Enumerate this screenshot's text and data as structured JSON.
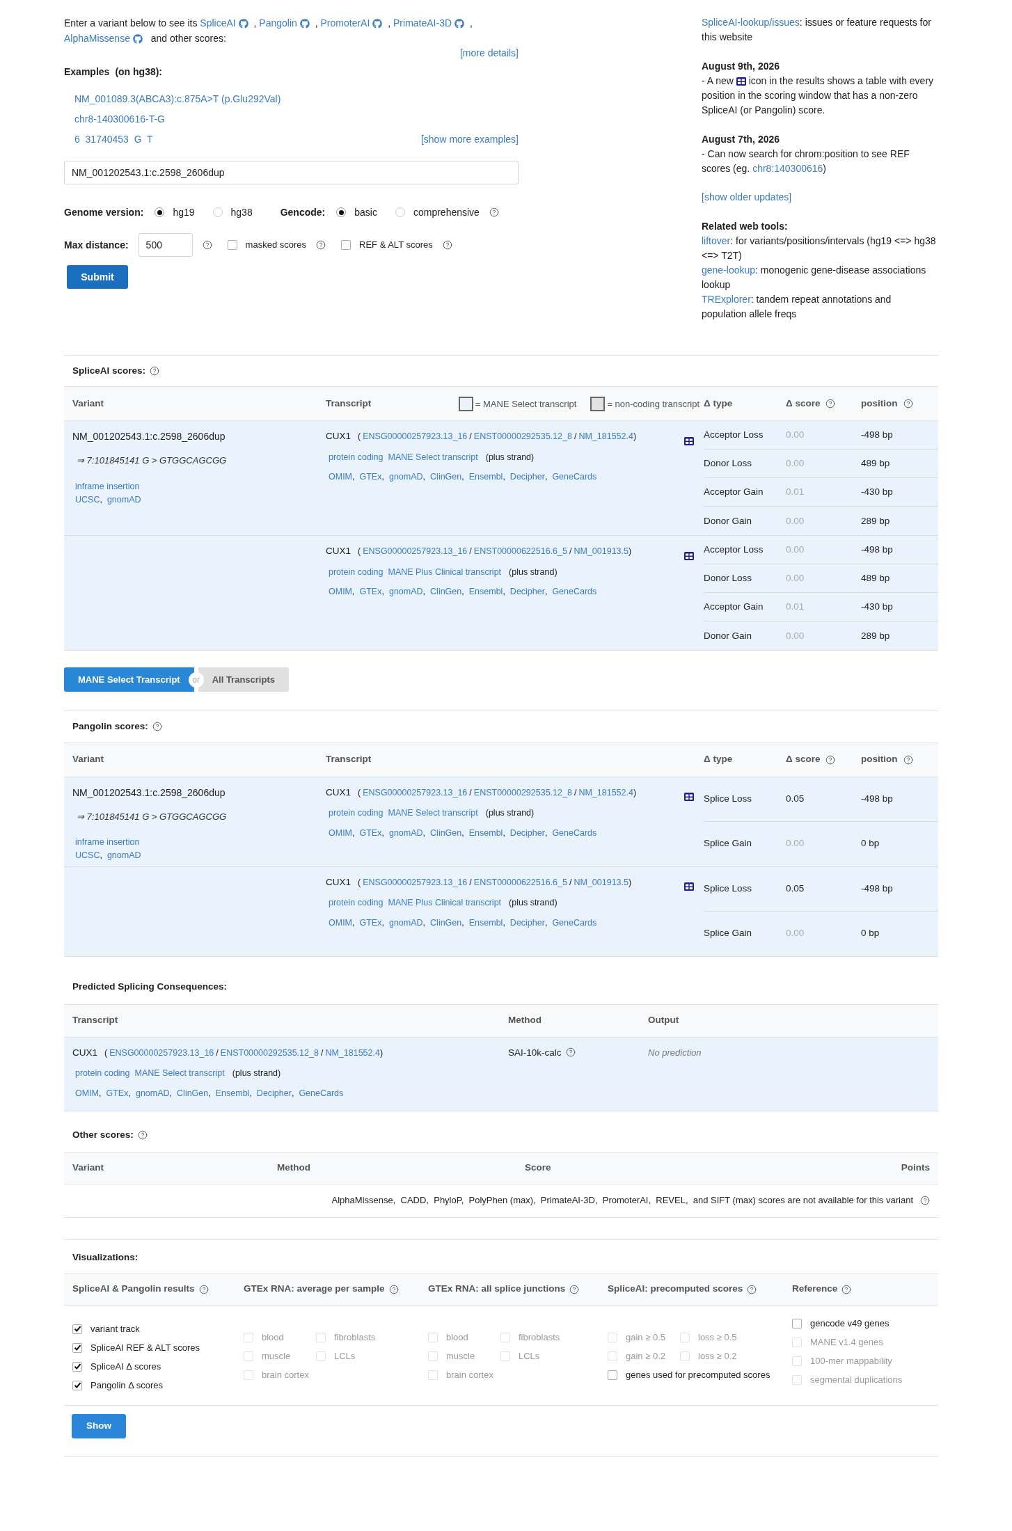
{
  "intro": {
    "parts": [
      {
        "kind": "text",
        "text": "Enter a variant below to see its "
      },
      {
        "kind": "link",
        "text": "SpliceAI",
        "github": true
      },
      {
        "kind": "text",
        "text": " , "
      },
      {
        "kind": "link",
        "text": "Pangolin",
        "github": true
      },
      {
        "kind": "text",
        "text": " , "
      },
      {
        "kind": "link",
        "text": "PromoterAI",
        "github": true
      },
      {
        "kind": "text",
        "text": " , "
      },
      {
        "kind": "link",
        "text": "PrimateAI-3D",
        "github": true
      },
      {
        "kind": "text",
        "text": " , "
      },
      {
        "kind": "link",
        "text": "AlphaMissense",
        "github": true
      },
      {
        "kind": "text",
        "text": "  and other scores:"
      }
    ],
    "more_details": "[more details]"
  },
  "examples": {
    "title": "Examples",
    "note": "(on hg38):",
    "items": [
      "NM_001089.3(ABCA3):c.875A>T (p.Glu292Val)",
      "chr8-140300616-T-G",
      "6  31740453  G  T"
    ],
    "show_more": "[show more examples]"
  },
  "variant_input": {
    "value": "NM_001202543.1:c.2598_2606dup"
  },
  "genome_version": {
    "label": "Genome version:",
    "options": [
      {
        "label": "hg19",
        "selected": true
      },
      {
        "label": "hg38",
        "selected": false
      }
    ]
  },
  "gencode": {
    "label": "Gencode:",
    "options": [
      {
        "label": "basic",
        "selected": true
      },
      {
        "label": "comprehensive",
        "selected": false
      }
    ]
  },
  "max_distance": {
    "label": "Max distance:",
    "value": "500"
  },
  "score_options": [
    {
      "label": "masked scores",
      "checked": false
    },
    {
      "label": "REF & ALT scores",
      "checked": false
    }
  ],
  "submit": "Submit",
  "sidebar": {
    "issues": [
      {
        "kind": "link",
        "text": "SpliceAI-lookup/issues"
      },
      {
        "kind": "text",
        "text": ": issues or feature requests for this website"
      }
    ],
    "updates": [
      {
        "date": "August 9th, 2026",
        "parts": [
          {
            "kind": "text",
            "text": "- A new "
          },
          {
            "kind": "icon"
          },
          {
            "kind": "text",
            "text": " icon in the results shows a table with every position in the scoring window that has a non-zero SpliceAI (or Pangolin) score."
          }
        ]
      },
      {
        "date": "August 7th, 2026",
        "parts": [
          {
            "kind": "text",
            "text": "- Can now search for chrom:position to see REF scores (eg. "
          },
          {
            "kind": "link",
            "text": "chr8:140300616"
          },
          {
            "kind": "text",
            "text": ")"
          }
        ]
      }
    ],
    "older": "[show older updates]",
    "related_title": "Related web tools:",
    "related": [
      [
        {
          "kind": "link",
          "text": "liftover"
        },
        {
          "kind": "text",
          "text": ": for variants/positions/intervals (hg19 <=> hg38 <=> T2T)"
        }
      ],
      [
        {
          "kind": "link",
          "text": "gene-lookup"
        },
        {
          "kind": "text",
          "text": ": monogenic gene-disease associations lookup"
        }
      ],
      [
        {
          "kind": "link",
          "text": "TRExplorer"
        },
        {
          "kind": "text",
          "text": ": tandem repeat annotations and population allele freqs"
        }
      ]
    ]
  },
  "spliceai": {
    "title": "SpliceAI scores:",
    "columns": [
      {
        "label": "Variant",
        "help": false
      },
      {
        "label": "Transcript",
        "help": false
      },
      {
        "label": "Δ type",
        "help": false
      },
      {
        "label": "Δ score",
        "help": true
      },
      {
        "label": "position",
        "help": true
      }
    ],
    "legend": [
      {
        "label": "= MANE Select transcript",
        "color": "#eaf2fc"
      },
      {
        "label": "= non-coding transcript",
        "color": "#e2e2e2"
      }
    ],
    "variant": {
      "hgvs": "NM_001202543.1:c.2598_2606dup",
      "normalized": "⇒ 7:101845141 G > GTGGCAGCGG",
      "consequence": "inframe insertion",
      "links": [
        {
          "label": "UCSC",
          "separator": ","
        },
        {
          "label": "gnomAD"
        }
      ]
    },
    "transcripts": [
      {
        "gene": "CUX1",
        "open": "(",
        "close": ")",
        "ids": [
          {
            "label": "ENSG00000257923.13_16",
            "separator": "/"
          },
          {
            "label": "ENST00000292535.12_8",
            "separator": "/"
          },
          {
            "label": "NM_181552.4"
          }
        ],
        "biotype": "protein coding",
        "mane": "MANE Select transcript",
        "strand": "(plus strand)",
        "links": [
          {
            "label": "OMIM",
            "separator": ","
          },
          {
            "label": "GTEx",
            "separator": ","
          },
          {
            "label": "gnomAD",
            "separator": ","
          },
          {
            "label": "ClinGen",
            "separator": ","
          },
          {
            "label": "Ensembl",
            "separator": ","
          },
          {
            "label": "Decipher",
            "separator": ","
          },
          {
            "label": "GeneCards"
          }
        ],
        "scores": [
          {
            "type": "Acceptor Loss",
            "score": "0.00",
            "dimmed": true,
            "position": "-498 bp"
          },
          {
            "type": "Donor Loss",
            "score": "0.00",
            "dimmed": true,
            "position": "489 bp"
          },
          {
            "type": "Acceptor Gain",
            "score": "0.01",
            "dimmed": true,
            "position": "-430 bp"
          },
          {
            "type": "Donor Gain",
            "score": "0.00",
            "dimmed": true,
            "position": "289 bp"
          }
        ]
      },
      {
        "gene": "CUX1",
        "open": "(",
        "close": ")",
        "ids": [
          {
            "label": "ENSG00000257923.13_16",
            "separator": "/"
          },
          {
            "label": "ENST00000622516.6_5",
            "separator": "/"
          },
          {
            "label": "NM_001913.5"
          }
        ],
        "biotype": "protein coding",
        "mane": "MANE Plus Clinical transcript",
        "strand": "(plus strand)",
        "links": [
          {
            "label": "OMIM",
            "separator": ","
          },
          {
            "label": "GTEx",
            "separator": ","
          },
          {
            "label": "gnomAD",
            "separator": ","
          },
          {
            "label": "ClinGen",
            "separator": ","
          },
          {
            "label": "Ensembl",
            "separator": ","
          },
          {
            "label": "Decipher",
            "separator": ","
          },
          {
            "label": "GeneCards"
          }
        ],
        "scores": [
          {
            "type": "Acceptor Loss",
            "score": "0.00",
            "dimmed": true,
            "position": "-498 bp"
          },
          {
            "type": "Donor Loss",
            "score": "0.00",
            "dimmed": true,
            "position": "489 bp"
          },
          {
            "type": "Acceptor Gain",
            "score": "0.01",
            "dimmed": true,
            "position": "-430 bp"
          },
          {
            "type": "Donor Gain",
            "score": "0.00",
            "dimmed": true,
            "position": "289 bp"
          }
        ]
      }
    ]
  },
  "transcript_toggle": {
    "options": [
      {
        "label": "MANE Select Transcript",
        "selected": true
      },
      {
        "label": "All Transcripts",
        "selected": false
      }
    ],
    "or": "or"
  },
  "pangolin": {
    "title": "Pangolin scores:",
    "columns": [
      {
        "label": "Variant",
        "help": false
      },
      {
        "label": "Transcript",
        "help": false
      },
      {
        "label": "Δ type",
        "help": false
      },
      {
        "label": "Δ score",
        "help": true
      },
      {
        "label": "position",
        "help": true
      }
    ],
    "variant": {
      "hgvs": "NM_001202543.1:c.2598_2606dup",
      "normalized": "⇒ 7:101845141 G > GTGGCAGCGG",
      "consequence": "inframe insertion",
      "links": [
        {
          "label": "UCSC",
          "separator": ","
        },
        {
          "label": "gnomAD"
        }
      ]
    },
    "transcripts": [
      {
        "gene": "CUX1",
        "open": "(",
        "close": ")",
        "ids": [
          {
            "label": "ENSG00000257923.13_16",
            "separator": "/"
          },
          {
            "label": "ENST00000292535.12_8",
            "separator": "/"
          },
          {
            "label": "NM_181552.4"
          }
        ],
        "biotype": "protein coding",
        "mane": "MANE Select transcript",
        "strand": "(plus strand)",
        "links": [
          {
            "label": "OMIM",
            "separator": ","
          },
          {
            "label": "GTEx",
            "separator": ","
          },
          {
            "label": "gnomAD",
            "separator": ","
          },
          {
            "label": "ClinGen",
            "separator": ","
          },
          {
            "label": "Ensembl",
            "separator": ","
          },
          {
            "label": "Decipher",
            "separator": ","
          },
          {
            "label": "GeneCards"
          }
        ],
        "scores": [
          {
            "type": "Splice Loss",
            "score": "0.05",
            "dimmed": false,
            "position": "-498 bp"
          },
          {
            "type": "Splice Gain",
            "score": "0.00",
            "dimmed": true,
            "position": "0 bp"
          }
        ]
      },
      {
        "gene": "CUX1",
        "open": "(",
        "close": ")",
        "ids": [
          {
            "label": "ENSG00000257923.13_16",
            "separator": "/"
          },
          {
            "label": "ENST00000622516.6_5",
            "separator": "/"
          },
          {
            "label": "NM_001913.5"
          }
        ],
        "biotype": "protein coding",
        "mane": "MANE Plus Clinical transcript",
        "strand": "(plus strand)",
        "links": [
          {
            "label": "OMIM",
            "separator": ","
          },
          {
            "label": "GTEx",
            "separator": ","
          },
          {
            "label": "gnomAD",
            "separator": ","
          },
          {
            "label": "ClinGen",
            "separator": ","
          },
          {
            "label": "Ensembl",
            "separator": ","
          },
          {
            "label": "Decipher",
            "separator": ","
          },
          {
            "label": "GeneCards"
          }
        ],
        "scores": [
          {
            "type": "Splice Loss",
            "score": "0.05",
            "dimmed": false,
            "position": "-498 bp"
          },
          {
            "type": "Splice Gain",
            "score": "0.00",
            "dimmed": true,
            "position": "0 bp"
          }
        ]
      }
    ]
  },
  "predicted": {
    "title": "Predicted Splicing Consequences:",
    "columns": [
      "Transcript",
      "Method",
      "Output"
    ],
    "rows": [
      {
        "gene": "CUX1",
        "open": "(",
        "close": ")",
        "ids": [
          {
            "label": "ENSG00000257923.13_16",
            "separator": "/"
          },
          {
            "label": "ENST00000292535.12_8",
            "separator": "/"
          },
          {
            "label": "NM_181552.4"
          }
        ],
        "biotype": "protein coding",
        "mane": "MANE Select transcript",
        "strand": "(plus strand)",
        "links": [
          {
            "label": "OMIM",
            "separator": ","
          },
          {
            "label": "GTEx",
            "separator": ","
          },
          {
            "label": "gnomAD",
            "separator": ","
          },
          {
            "label": "ClinGen",
            "separator": ","
          },
          {
            "label": "Ensembl",
            "separator": ","
          },
          {
            "label": "Decipher",
            "separator": ","
          },
          {
            "label": "GeneCards"
          }
        ],
        "method": "SAI-10k-calc",
        "output": "No prediction"
      }
    ]
  },
  "other_scores": {
    "title": "Other scores:",
    "columns": [
      "Variant",
      "Method",
      "Score",
      "Points"
    ],
    "message": "AlphaMissense,  CADD,  PhyloP,  PolyPhen (max),  PrimateAI-3D,  PromoterAI,  REVEL,  and SIFT (max) scores are not available for this variant"
  },
  "visualizations": {
    "title": "Visualizations:",
    "groups": [
      {
        "title": "SpliceAI & Pangolin results",
        "rows": [
          [
            {
              "label": "variant track",
              "checked": true,
              "disabled": false
            }
          ],
          [
            {
              "label": "SpliceAI REF & ALT scores",
              "checked": true,
              "disabled": false
            }
          ],
          [
            {
              "label": "SpliceAI Δ scores",
              "checked": true,
              "disabled": false
            }
          ],
          [
            {
              "label": "Pangolin Δ  scores",
              "checked": true,
              "disabled": false
            }
          ]
        ]
      },
      {
        "title": "GTEx RNA: average per sample",
        "rows": [
          [
            {
              "label": "blood",
              "checked": false,
              "disabled": true
            },
            {
              "label": "fibroblasts",
              "checked": false,
              "disabled": true
            }
          ],
          [
            {
              "label": "muscle",
              "checked": false,
              "disabled": true
            },
            {
              "label": "LCLs",
              "checked": false,
              "disabled": true
            }
          ],
          [
            {
              "label": "brain cortex",
              "checked": false,
              "disabled": true
            }
          ]
        ]
      },
      {
        "title": "GTEx RNA: all splice junctions",
        "rows": [
          [
            {
              "label": "blood",
              "checked": false,
              "disabled": true
            },
            {
              "label": "fibroblasts",
              "checked": false,
              "disabled": true
            }
          ],
          [
            {
              "label": "muscle",
              "checked": false,
              "disabled": true
            },
            {
              "label": "LCLs",
              "checked": false,
              "disabled": true
            }
          ],
          [
            {
              "label": "brain cortex",
              "checked": false,
              "disabled": true
            }
          ]
        ]
      },
      {
        "title": "SpliceAI: precomputed scores",
        "rows": [
          [
            {
              "label": "gain ≥ 0.5",
              "checked": false,
              "disabled": true
            },
            {
              "label": "loss ≥ 0.5",
              "checked": false,
              "disabled": true
            }
          ],
          [
            {
              "label": "gain ≥ 0.2",
              "checked": false,
              "disabled": true
            },
            {
              "label": "loss ≥ 0.2",
              "checked": false,
              "disabled": true
            }
          ],
          [
            {
              "label": "genes used for precomputed scores",
              "checked": false,
              "disabled": false
            }
          ]
        ]
      },
      {
        "title": "Reference",
        "rows": [
          [
            {
              "label": "gencode v49 genes",
              "checked": false,
              "disabled": false
            }
          ],
          [
            {
              "label": "MANE v1.4 genes",
              "checked": false,
              "disabled": true
            }
          ],
          [
            {
              "label": "100-mer mappability",
              "checked": false,
              "disabled": true
            }
          ],
          [
            {
              "label": "segmental duplications",
              "checked": false,
              "disabled": true
            }
          ]
        ]
      }
    ],
    "show": "Show"
  }
}
